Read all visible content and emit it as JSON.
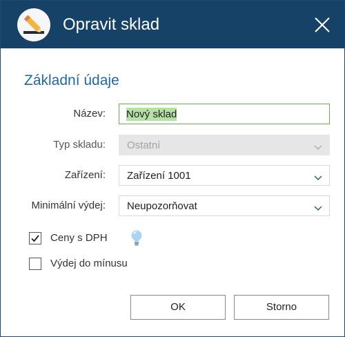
{
  "window": {
    "title": "Opravit sklad",
    "icon": "edit-pencil-icon",
    "close_icon": "close-icon"
  },
  "section": {
    "title": "Základní údaje"
  },
  "form": {
    "name": {
      "label": "Název:",
      "value": "Nový sklad"
    },
    "warehouse_type": {
      "label": "Typ skladu:",
      "value": "Ostatní",
      "disabled": true
    },
    "device": {
      "label": "Zařízení:",
      "value": "Zařízení 1001"
    },
    "min_issue": {
      "label": "Minimální výdej:",
      "value": "Neupozorňovat"
    },
    "prices_with_vat": {
      "label": "Ceny s DPH",
      "checked": true,
      "hint_icon": "lightbulb-icon"
    },
    "issue_below_zero": {
      "label": "Výdej do mínusu",
      "checked": false
    }
  },
  "buttons": {
    "ok": "OK",
    "cancel": "Storno"
  },
  "colors": {
    "titlebar": "#174268",
    "accent": "#2167a5",
    "input_focus": "#62b34c",
    "selection": "#b6e1a4"
  }
}
